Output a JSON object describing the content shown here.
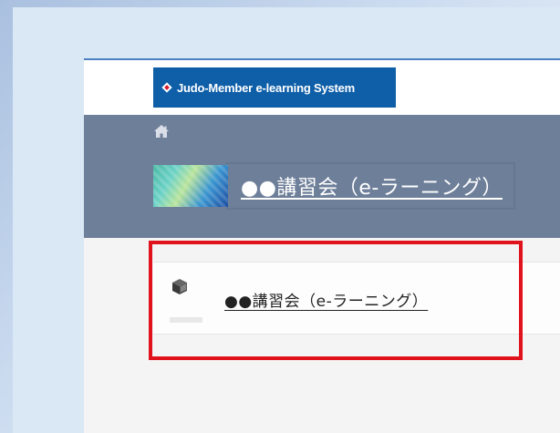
{
  "app": {
    "logo_text": "Judo-Member e-learning System"
  },
  "breadcrumb": {
    "home_icon": "home-icon"
  },
  "course_header": {
    "title": "●●講習会（e-ラーニング）"
  },
  "course_list": {
    "items": [
      {
        "label": "●●講習会（e-ラーニング）",
        "icon": "book-icon"
      }
    ]
  },
  "colors": {
    "logo_bg": "#0f5fa8",
    "hero_bg": "#6e7f99",
    "highlight": "#e0131d"
  }
}
